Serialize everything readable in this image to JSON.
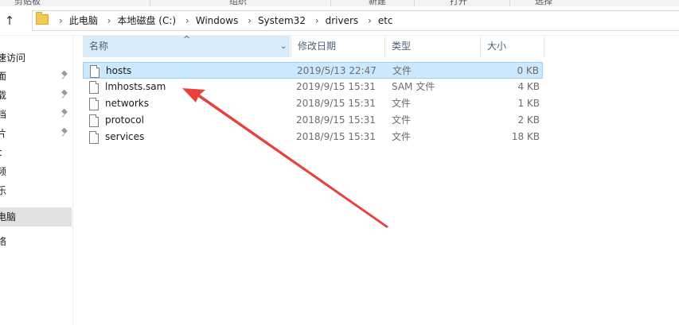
{
  "ribbon": {
    "groups": [
      "剪贴板",
      "组织",
      "新建",
      "打开",
      "选择"
    ]
  },
  "address": {
    "crumbs": [
      "此电脑",
      "本地磁盘 (C:)",
      "Windows",
      "System32",
      "drivers",
      "etc"
    ]
  },
  "nav": {
    "items": [
      {
        "label": "速访问",
        "pinned": false,
        "selected": false
      },
      {
        "label": "面",
        "pinned": true,
        "selected": false
      },
      {
        "label": "载",
        "pinned": true,
        "selected": false
      },
      {
        "label": "档",
        "pinned": true,
        "selected": false
      },
      {
        "label": "片",
        "pinned": true,
        "selected": false
      },
      {
        "label": "c",
        "pinned": false,
        "selected": false
      },
      {
        "label": "频",
        "pinned": false,
        "selected": false
      },
      {
        "label": "乐",
        "pinned": false,
        "selected": false
      },
      {
        "label": "电脑",
        "pinned": false,
        "selected": true
      },
      {
        "label": "络",
        "pinned": false,
        "selected": false
      }
    ]
  },
  "columns": {
    "name": "名称",
    "date": "修改日期",
    "type": "类型",
    "size": "大小"
  },
  "files": [
    {
      "name": "hosts",
      "date": "2019/5/13 22:47",
      "type": "文件",
      "size": "0 KB",
      "selected": true
    },
    {
      "name": "lmhosts.sam",
      "date": "2019/9/15 15:31",
      "type": "SAM 文件",
      "size": "4 KB",
      "selected": false
    },
    {
      "name": "networks",
      "date": "2018/9/15 15:31",
      "type": "文件",
      "size": "1 KB",
      "selected": false
    },
    {
      "name": "protocol",
      "date": "2018/9/15 15:31",
      "type": "文件",
      "size": "2 KB",
      "selected": false
    },
    {
      "name": "services",
      "date": "2018/9/15 15:31",
      "type": "文件",
      "size": "18 KB",
      "selected": false
    }
  ],
  "annotation": {
    "color": "#e8413c",
    "icon": "red-arrow-annotation"
  }
}
